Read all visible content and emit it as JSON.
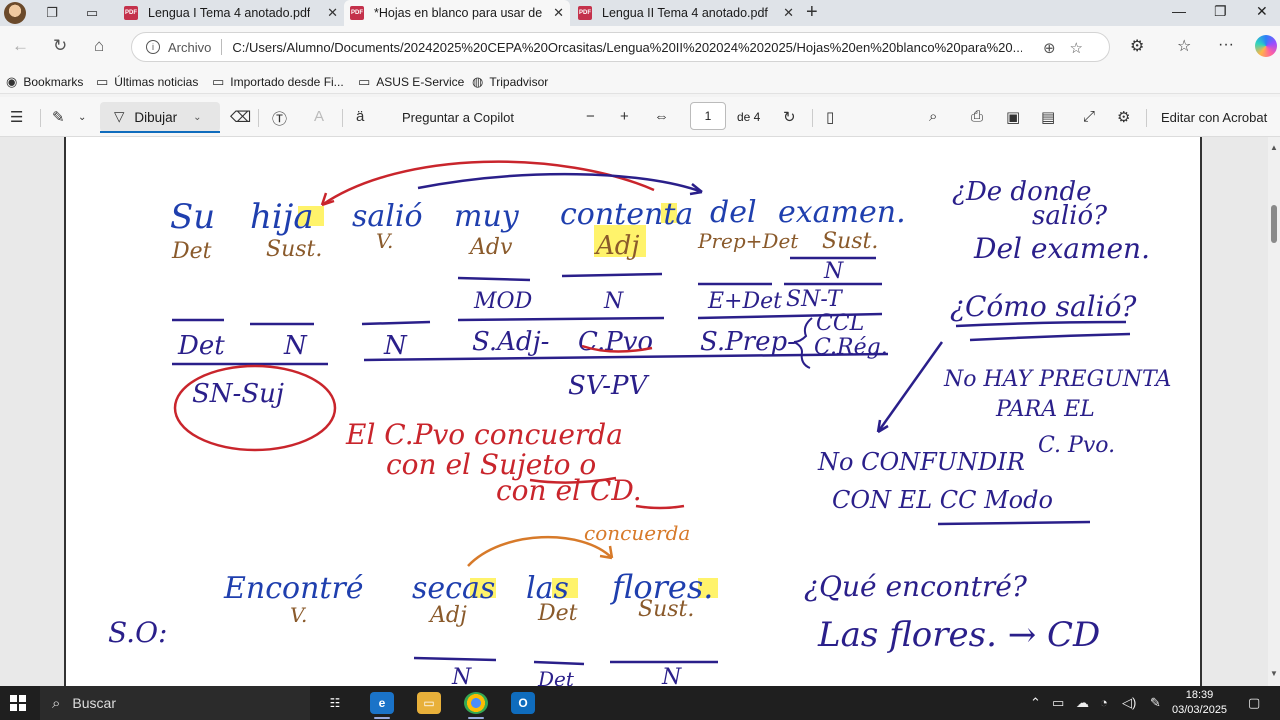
{
  "browser": {
    "tabs": [
      {
        "label": "Lengua I Tema 4 anotado.pdf",
        "active": false
      },
      {
        "label": "*Hojas en blanco para usar de piz",
        "active": true
      },
      {
        "label": "Lengua II Tema 4 anotado.pdf",
        "active": false
      }
    ],
    "address": {
      "scheme_label": "Archivo",
      "url": "C:/Users/Alumno/Documents/20242025%20CEPA%20Orcasitas/Lengua%20II%202024%202025/Hojas%20en%20blanco%20para%20..."
    },
    "bookmarks": [
      {
        "label": "Bookmarks",
        "icon": "bookmarks-icon"
      },
      {
        "label": "Últimas noticias",
        "icon": "folder-icon"
      },
      {
        "label": "Importado desde Fi...",
        "icon": "folder-icon"
      },
      {
        "label": "ASUS E-Service",
        "icon": "folder-icon"
      },
      {
        "label": "Tripadvisor",
        "icon": "globe-icon"
      }
    ]
  },
  "pdf_toolbar": {
    "draw_label": "Dibujar",
    "copilot_label": "Preguntar a Copilot",
    "page_current": "1",
    "page_of": "de 4",
    "acrobat_label": "Editar con Acrobat"
  },
  "notes": {
    "sentence1": {
      "words": [
        "Su",
        "hija",
        "salió",
        "muy",
        "contenta",
        "del",
        "examen."
      ],
      "cats": [
        "Det",
        "Sust.",
        "V.",
        "Adv",
        "Adj",
        "Prep+Det",
        "Sust."
      ],
      "row2": [
        "MOD",
        "N",
        "E+Det",
        "SN-T",
        "N"
      ],
      "row3": [
        "Det",
        "N",
        "N",
        "S.Adj-",
        "C.Pvo",
        "S.Prep-",
        "CCL",
        "C.Rég."
      ],
      "svpv": "SV-PV",
      "snsuj": "SN-Suj",
      "note_lines": [
        "El C.Pvo concuerda",
        "con el Sujeto o",
        "con el CD."
      ]
    },
    "right": {
      "q1": [
        "¿De donde",
        "salió?"
      ],
      "a1": "Del examen.",
      "q2": "¿Cómo salió?",
      "a2": [
        "No HAY PREGUNTA",
        "PARA EL",
        "C. Pvo."
      ],
      "warn": [
        "No CONFUNDIR",
        "CON EL CC Modo"
      ],
      "q3": "¿Qué encontré?",
      "a3": "Las flores. → CD"
    },
    "sentence2": {
      "words": [
        "Encontré",
        "secas",
        "las",
        "flores."
      ],
      "cats": [
        "V.",
        "Adj",
        "Det",
        "Sust."
      ],
      "concuerda": "concuerda",
      "so": "S.O:",
      "row_n": [
        "N",
        "Det",
        "N"
      ]
    }
  },
  "taskbar": {
    "search_label": "Buscar",
    "time": "18:39",
    "date": "03/03/2025"
  }
}
